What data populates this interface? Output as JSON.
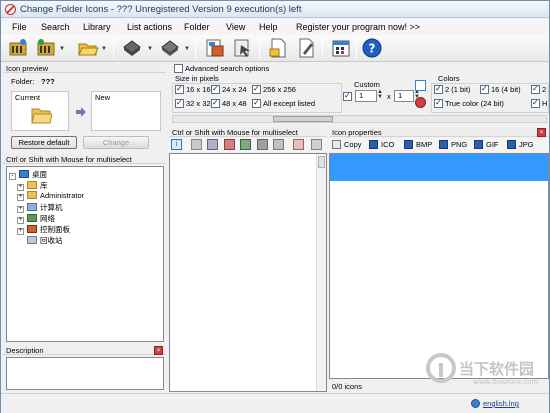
{
  "window": {
    "title": "Change Folder Icons - ??? Unregistered Version 9 execution(s) left"
  },
  "menu": [
    "File",
    "Search",
    "Library",
    "List actions",
    "Folder",
    "View",
    "Help",
    "Register your program now!  >>"
  ],
  "toolbar": {
    "icons": [
      "scan-folders-icon",
      "scan-folders-options-icon",
      "open-folder-icon",
      "drive-icon",
      "drive-options-icon",
      "apply-icon-icon",
      "restore-icon-icon",
      "new-document-icon",
      "edit-icon",
      "calendar-icon",
      "help-icon"
    ]
  },
  "icon_preview": {
    "header": "Icon preview",
    "folder_label": "Folder:",
    "folder_value": "???",
    "current_label": "Current",
    "new_label": "New",
    "restore_button": "Restore default",
    "change_button": "Change"
  },
  "tree_panel": {
    "header": "Ctrl or Shift with Mouse for multiselect",
    "items": [
      {
        "label": "桌面",
        "level": 0,
        "expander": "-"
      },
      {
        "label": "库",
        "level": 1,
        "expander": "+"
      },
      {
        "label": "Administrator",
        "level": 1,
        "expander": "+"
      },
      {
        "label": "计算机",
        "level": 1,
        "expander": "+"
      },
      {
        "label": "网络",
        "level": 1,
        "expander": "+"
      },
      {
        "label": "控制面板",
        "level": 1,
        "expander": "+"
      },
      {
        "label": "回收站",
        "level": 1,
        "expander": ""
      }
    ]
  },
  "description": {
    "header": "Description"
  },
  "search_options": {
    "advanced_label": "Advanced search options",
    "size_label": "Size in pixels",
    "sizes": [
      {
        "label": "16 x 16",
        "checked": true
      },
      {
        "label": "24 x 24",
        "checked": true
      },
      {
        "label": "256 x 256",
        "checked": true
      },
      {
        "label": "32 x 32",
        "checked": true
      },
      {
        "label": "48 x 48",
        "checked": true
      },
      {
        "label": "All except listed",
        "checked": true
      }
    ],
    "custom_label": "Custom",
    "custom_checked": true,
    "custom_w": "1",
    "custom_x": "x",
    "custom_h": "1",
    "colors_label": "Colors",
    "colors": [
      {
        "label": "2 (1 bit)",
        "checked": true
      },
      {
        "label": "16 (4 bit)",
        "checked": true
      },
      {
        "label": "2",
        "checked": true
      },
      {
        "label": "True color (24 bit)",
        "checked": true
      },
      {
        "label": "H",
        "checked": true
      }
    ]
  },
  "list_panel": {
    "header": "Ctrl or Shift with Mouse for multiselect"
  },
  "icon_props": {
    "header": "Icon properties",
    "actions": [
      "Copy",
      "ICO",
      "BMP",
      "PNG",
      "GIF",
      "JPG"
    ],
    "status": "0/0 icons"
  },
  "status": {
    "language": "english.lng"
  },
  "watermark": {
    "brand": "当下软件园",
    "url": "www.downxia.com"
  }
}
